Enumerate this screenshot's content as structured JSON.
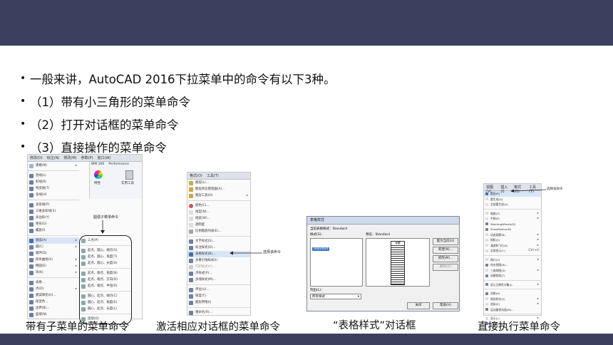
{
  "bullets": [
    "一般来讲，AutoCAD 2016下拉菜单中的命令有以下3种。",
    "（1）带有小三角形的菜单命令",
    "（2）打开对话框的菜单命令",
    "（3）直接操作的菜单命令"
  ],
  "captions": {
    "c1": "带有子菜单的菜单命令",
    "c2": "激活相应对话框的菜单命令",
    "c3": "“表格样式”对话框",
    "c4": "直接执行菜单命令"
  },
  "shot1": {
    "menubar": [
      "修改(D)",
      "标注(N)",
      "修改(M)",
      "参数(P)",
      "窗口(W)"
    ],
    "items": [
      "建模(M)",
      "直线(L)",
      "射线(R)",
      "构造线(T)",
      "多线(U)",
      "多段线(P)",
      "三维多段线(3)",
      "多边形(Y)",
      "矩形(G)",
      "螺旋(I)",
      "圆弧(A)",
      "圆(C)",
      "圆环(D)",
      "样条曲线(S)",
      "椭圆(E)",
      "块(K)",
      "表格...",
      "点(O)",
      "图案填充(H)...",
      "渐变色...",
      "边界(B)...",
      "面域(N)"
    ],
    "sub_items": [
      "三点(P)",
      "起点、圆心、端点(S)",
      "起点、圆心、角度(T)",
      "起点、圆心、长度(A)",
      "起点、端点、角度(N)",
      "起点、端点、方向(D)",
      "起点、端点、半径(R)",
      "圆心、起点、端点(C)",
      "圆心、起点、角度(E)",
      "圆心、起点、长度(L)",
      "连续(O)"
    ],
    "callout": "圆弧子菜单命令",
    "ribbon_labels": [
      "BIM 360",
      "Performance",
      "特性",
      "实用工具"
    ]
  },
  "shot2": {
    "menubar": [
      "格式(O)",
      "工具(T)"
    ],
    "items": [
      "图层(L)...",
      "图层状态管理器(A)...",
      "图层工具(O)",
      "颜色(C)...",
      "线型(N)...",
      "线宽(W)...",
      "透明度",
      "比例缩放列表(E)...",
      "文字样式(S)...",
      "标注样式(D)...",
      "表格样式(B)...",
      "多重引线样式(I)",
      "打印样式(Y)...",
      "点样式(P)...",
      "多线样式(M)...",
      "单位(U)...",
      "厚度(T)",
      "图形界限(I)",
      "重命名(R)..."
    ],
    "callout": "选择该命令"
  },
  "shot3": {
    "title": "表格样式",
    "current_label": "当前表格样式：Standard",
    "styles_label": "样式(S)：",
    "style_item": "Standard",
    "preview_label": "预览：Standard",
    "preview_header": "标题",
    "list_label": "列出(L)：",
    "list_value": "所有样式",
    "buttons": [
      "置为当前(U)",
      "新建(N)...",
      "修改(M)...",
      "删除(D)"
    ],
    "close": "关闭",
    "help": "帮助(H)"
  },
  "shot4": {
    "menubar": [
      "视图(V)",
      "插入(I)",
      "格式(O)",
      "工具(T)"
    ],
    "items": [
      "重画(R)",
      "重生成(G)",
      "全部重生成(A)",
      "缩放(Z)",
      "平移(P)",
      "SteeringWheels(S)",
      "ShowMotion(M)",
      "动态观察(B)",
      "相机(C)",
      "漫游和飞行(K)",
      "全屏显示(C)",
      "视口(V)",
      "命名视图(N)...",
      "三维视图(D)",
      "创建相机(T)",
      "显示注释性对象(I)",
      "消隐(H)",
      "视觉样式(S)",
      "渲染(E)",
      "运动路径动画(M)...",
      "显示(L)",
      "工具栏(O)..."
    ],
    "shortcut": "Ctrl+0",
    "callout": "选择该命令"
  }
}
